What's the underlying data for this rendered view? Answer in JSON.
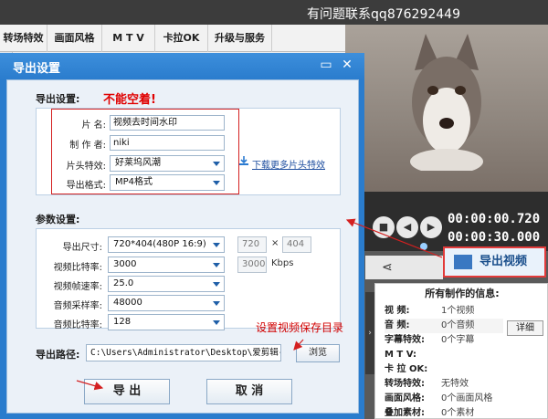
{
  "app": {
    "title": "有问题联系qq876292449",
    "tabs": [
      "转场特效",
      "画面风格",
      "M T V",
      "卡拉OK",
      "升级与服务"
    ]
  },
  "player": {
    "time_current": "00:00:00.720",
    "time_total": "00:00:30.000",
    "controls": [
      "stop-icon",
      "prev-icon",
      "next-icon"
    ]
  },
  "export_video_button": "导出视频",
  "info_panel": {
    "title": "所有制作的信息:",
    "detail_button": "详细",
    "rows": [
      {
        "key": "视    频:",
        "value": "1个视频"
      },
      {
        "key": "音    频:",
        "value": "0个音频"
      },
      {
        "key": "字幕特效:",
        "value": "0个字幕"
      },
      {
        "key": "M  T  V:",
        "value": ""
      },
      {
        "key": "卡 拉 OK:",
        "value": ""
      },
      {
        "key": "转场特效:",
        "value": "无特效"
      },
      {
        "key": "画面风格:",
        "value": "0个画面风格"
      },
      {
        "key": "叠加素材:",
        "value": "0个素材"
      }
    ]
  },
  "dialog": {
    "title": "导出设置",
    "export_section": {
      "label": "导出设置:",
      "warning": "不能空着!",
      "title_label": "片    名:",
      "title_value": "视频去时间水印",
      "author_label": "制 作 者:",
      "author_value": "niki",
      "intro_label": "片头特效:",
      "intro_value": "好莱坞风潮",
      "format_label": "导出格式:",
      "format_value": "MP4格式",
      "download_link": "下载更多片头特效"
    },
    "params_section": {
      "label": "参数设置:",
      "size_label": "导出尺寸:",
      "size_value": "720*404(480P 16:9)",
      "size_w": "720",
      "size_x": "×",
      "size_h": "404",
      "vbitrate_label": "视频比特率:",
      "vbitrate_value": "3000",
      "vbitrate_ro": "3000",
      "vbitrate_unit": "Kbps",
      "fps_label": "视频帧速率:",
      "fps_value": "25.0",
      "asample_label": "音频采样率:",
      "asample_value": "48000",
      "abitrate_label": "音频比特率:",
      "abitrate_value": "128"
    },
    "path_annotation": "设置视频保存目录",
    "path_label": "导出路径:",
    "path_value": "C:\\Users\\Administrator\\Desktop\\爱剪辑-我的视",
    "browse_button": "浏览",
    "export_button": "导 出",
    "cancel_button": "取 消"
  },
  "colors": {
    "dialog_blue": "#2a7ccd",
    "warning_red": "#e00000",
    "annotation_red": "#d42020"
  }
}
